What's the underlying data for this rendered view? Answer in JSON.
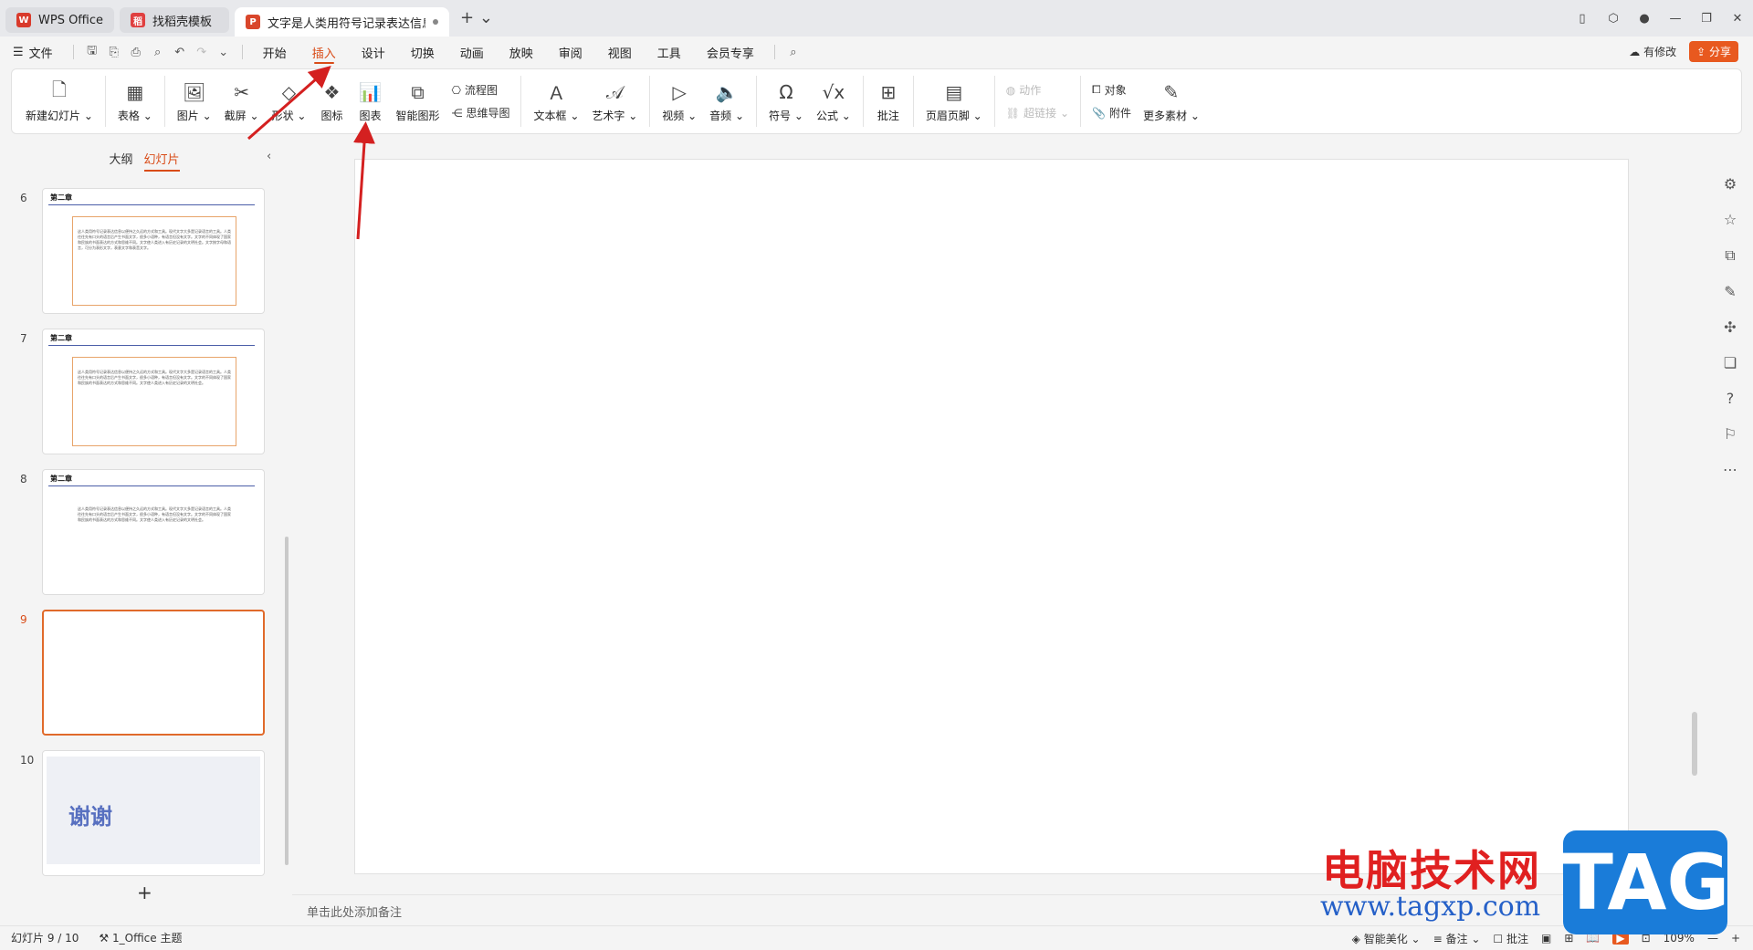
{
  "tabs": [
    {
      "label": "WPS Office",
      "logo": "W",
      "color": "#d93a2b"
    },
    {
      "label": "找稻壳模板",
      "logo": "稻",
      "color": "#e04040"
    },
    {
      "label": "文字是人类用符号记录表达信息以",
      "logo": "P",
      "color": "#d9462b"
    }
  ],
  "menubar": {
    "file": "文件",
    "items": [
      "开始",
      "插入",
      "设计",
      "切换",
      "动画",
      "放映",
      "审阅",
      "视图",
      "工具",
      "会员专享"
    ],
    "active": "插入",
    "revise": "有修改",
    "share": "分享"
  },
  "ribbon": {
    "new_slide": "新建幻灯片",
    "table": "表格",
    "picture": "图片",
    "screenshot": "截屏",
    "shape": "形状",
    "icon": "图标",
    "chart": "图表",
    "smartart": "智能图形",
    "flowchart": "流程图",
    "mindmap": "思维导图",
    "textbox": "文本框",
    "wordart": "艺术字",
    "video": "视频",
    "audio": "音频",
    "symbol": "符号",
    "formula": "公式",
    "comment": "批注",
    "header_footer": "页眉页脚",
    "action": "动作",
    "hyperlink": "超链接",
    "object": "对象",
    "attachment": "附件",
    "more": "更多素材"
  },
  "leftpanel": {
    "tab_outline": "大纲",
    "tab_slides": "幻灯片",
    "slides": [
      {
        "num": "6",
        "title": "第二章",
        "body": "这人类用符号记录表达信息以便持之久远的方式和工具。现代文字大多是记录语言的工具。人类往往先有口头的语言后产生书面文字，很多小语种，有语言但没有文字。文字的不同体现了国家和民族的书面表达的方式和思维不同。文字使人类进入有历史记录的文明社会。文字按字母和语言，可分为表形文字，表意文字和表音文字。"
      },
      {
        "num": "7",
        "title": "第二章",
        "body": "这人类用符号记录表达信息以便持之久远的方式和工具。现代文字大多是记录语言的工具。人类往往先有口头的语言后产生书面文字，很多小语种，有语言但没有文字。文字的不同体现了国家和民族的书面表达的方式和思维不同。文字使人类进入有历史记录的文明社会。"
      },
      {
        "num": "8",
        "title": "第二章",
        "body": "这人类用符号记录表达信息以便持之久远的方式和工具。现代文字大多是记录语言的工具。人类往往先有口头的语言后产生书面文字，很多小语种，有语言但没有文字。文字的不同体现了国家和民族的书面表达的方式和思维不同。文字使人类进入有历史记录的文明社会。"
      },
      {
        "num": "9",
        "title": "",
        "body": ""
      },
      {
        "num": "10",
        "title": "谢谢",
        "body": ""
      }
    ]
  },
  "notes_placeholder": "单击此处添加备注",
  "status": {
    "slide_counter": "幻灯片 9 / 10",
    "theme": "1_Office 主题",
    "beautify": "智能美化",
    "notes": "备注",
    "comment": "批注",
    "zoom": "109%"
  },
  "watermark": {
    "cn": "电脑技术网",
    "url": "www.tagxp.com",
    "tag": "TAG"
  },
  "colors": {
    "accent": "#d94c18",
    "share_bg": "#e8591f",
    "selected_border": "#e06a2b",
    "annotation_arrow": "#d42020"
  }
}
